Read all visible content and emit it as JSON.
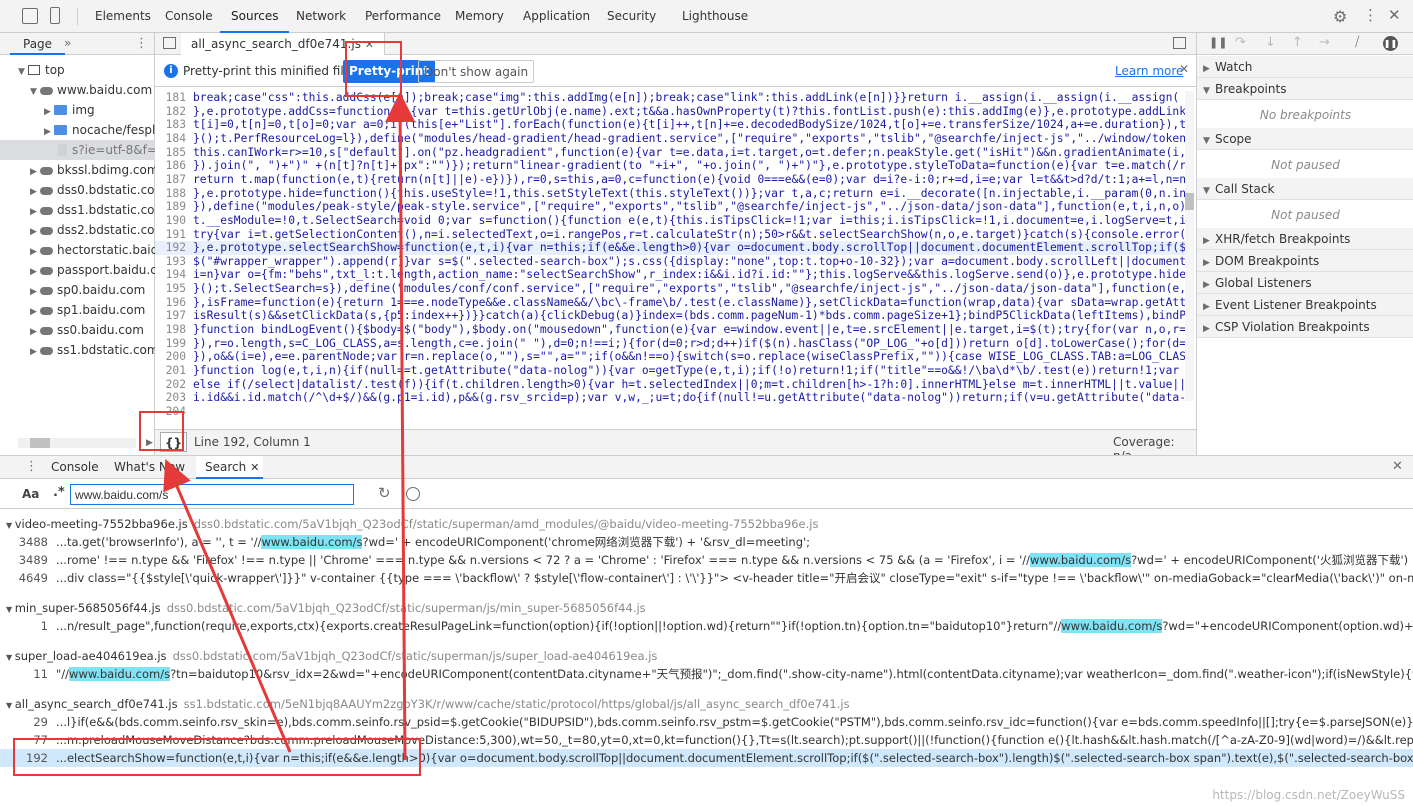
{
  "main_tabs": [
    "Elements",
    "Console",
    "Sources",
    "Network",
    "Performance",
    "Memory",
    "Application",
    "Security",
    "Lighthouse"
  ],
  "navigator": {
    "tab": "Page",
    "items": [
      {
        "label": "top",
        "kind": "frame"
      },
      {
        "label": "www.baidu.com",
        "kind": "cloud"
      },
      {
        "label": "img",
        "kind": "folder"
      },
      {
        "label": "nocache/fesplg",
        "kind": "folder"
      },
      {
        "label": "s?ie=utf-8&f=8",
        "kind": "file"
      },
      {
        "label": "bkssl.bdimg.com",
        "kind": "cloud"
      },
      {
        "label": "dss0.bdstatic.com",
        "kind": "cloud"
      },
      {
        "label": "dss1.bdstatic.com",
        "kind": "cloud"
      },
      {
        "label": "dss2.bdstatic.com",
        "kind": "cloud"
      },
      {
        "label": "hectorstatic.baidu",
        "kind": "cloud"
      },
      {
        "label": "passport.baidu.co",
        "kind": "cloud"
      },
      {
        "label": "sp0.baidu.com",
        "kind": "cloud"
      },
      {
        "label": "sp1.baidu.com",
        "kind": "cloud"
      },
      {
        "label": "ss0.baidu.com",
        "kind": "cloud"
      },
      {
        "label": "ss1.bdstatic.com",
        "kind": "cloud"
      }
    ]
  },
  "editor": {
    "file_tab": "all_async_search_df0e741.js",
    "infobar": {
      "message": "Pretty-print this minified file?",
      "pretty_button": "Pretty-print",
      "dismiss_button": "Don't show again",
      "learn_more": "Learn more"
    },
    "lines": [
      {
        "n": "181",
        "t": "break;case\"css\":this.addCss(e[n]);break;case\"img\":this.addImg(e[n]);break;case\"link\":this.addLink(e[n])}}return i.__assign(i.__assign(i.__assign("
      },
      {
        "n": "182",
        "t": "},e.prototype.addCss=function(e){var t=this.getUrlObj(e.name).ext;t&&a.hasOwnProperty(t)?this.fontList.push(e):this.addImg(e)},e.prototype.addLink=fu"
      },
      {
        "n": "183",
        "t": "t[i]=0,t[n]=0,t[o]=0;var a=0;if(this[e+\"List\"].forEach(function(e){t[i]++,t[n]+=e.decodedBodySize/1024,t[o]+=e.transferSize/1024,a+=e.duration}),t[s"
      },
      {
        "n": "184",
        "t": "}();t.PerfResourceLog=l}),define(\"modules/head-gradient/head-gradient.service\",[\"require\",\"exports\",\"tslib\",\"@searchfe/inject-js\",\"../window/token\",\""
      },
      {
        "n": "185",
        "t": "this.canIWork=r>=10,s[\"default\"].on(\"pz.headgradient\",function(e){var t=e.data,i=t.target,o=t.defer;n.peakStyle.get(\"isHit\")&&n.gradientAnimate(i,o)}"
      },
      {
        "n": "186",
        "t": "}).join(\", \")+\")\" +(n[t]?n[t]+\"px\":\"\")});return\"linear-gradient(to \"+i+\", \"+o.join(\", \")+\")\"},e.prototype.styleToData=function(e){var t=e.match(/rgba"
      },
      {
        "n": "187",
        "t": "return t.map(function(e,t){return(n[t]||e)-e})}),r=0,s=this,a=0,c=function(e){void 0===e&&(e=0);var d=i?e-i:0;r+=d,i=e;var l=t&&t>d?d/t:1;a+=l,n=n.ma"
      },
      {
        "n": "188",
        "t": "},e.prototype.hide=function(){this.useStyle=!1,this.setStyleText(this.styleText())};var t,a,c;return e=i.__decorate([n.injectable,i.__param(0,n.injec"
      },
      {
        "n": "189",
        "t": "}),define(\"modules/peak-style/peak-style.service\",[\"require\",\"exports\",\"tslib\",\"@searchfe/inject-js\",\"../json-data/json-data\"],function(e,t,i,n,o){"
      },
      {
        "n": "190",
        "t": "t.__esModule=!0,t.SelectSearch=void 0;var s=function(){function e(e,t){this.isTipsClick=!1;var i=this;i.isTipsClick=!1,i.document=e,i.logServe=t,i.se"
      },
      {
        "n": "191",
        "t": "try{var i=t.getSelectionContent(),n=i.selectedText,o=i.rangePos,r=t.calculateStr(n);50>r&&t.selectSearchShow(n,o,e.target)}catch(s){console.error(s)"
      },
      {
        "n": "192",
        "t": "},e.prototype.selectSearchShow=function(e,t,i){var n=this;if(e&&e.length>0){var o=document.body.scrollTop||document.documentElement.scrollTop;if($(\""
      },
      {
        "n": "193",
        "t": "$(\"#wrapper_wrapper\").append(r)}var s=$(\".selected-search-box\");s.css({display:\"none\",top:t.top+o-10-32});var a=document.body.scrollLeft||document.do"
      },
      {
        "n": "194",
        "t": "i=n}var o={fm:\"behs\",txt_l:t.length,action_name:\"selectSearchShow\",r_index:i&&i.id?i.id:\"\"};this.logServe&&this.logServe.send(o)},e.prototype.hideNo"
      },
      {
        "n": "195",
        "t": "}();t.SelectSearch=s}),define(\"modules/conf/conf.service\",[\"require\",\"exports\",\"tslib\",\"@searchfe/inject-js\",\"../json-data/json-data\"],function(e,t,i"
      },
      {
        "n": "196",
        "t": "},isFrame=function(e){return 1===e.nodeType&&e.className&&/\\bc\\-frame\\b/.test(e.className)},setClickData=function(wrap,data){var sData=wrap.getAttribu"
      },
      {
        "n": "197",
        "t": "isResult(s)&&setClickData(s,{p5:index++})}}catch(a){clickDebug(a)}index=(bds.comm.pageNum-1)*bds.comm.pageSize+1};bindP5ClickData(leftItems),bindP5Cl"
      },
      {
        "n": "198",
        "t": "}function bindLogEvent(){$body=$(\"body\"),$body.on(\"mousedown\",function(e){var e=window.event||e,t=e.srcElement||e.target,i=$(t);try{for(var n,o,r=i;r"
      },
      {
        "n": "199",
        "t": "}),r=o.length,s=C_LOG_CLASS,a=s.length,c=e.join(\" \"),d=0;n!==i;){for(d=0;r>d;d++)if($(n).hasClass(\"OP_LOG_\"+o[d]))return o[d].toLowerCase();for(d=0;a"
      },
      {
        "n": "200",
        "t": "}),o&&(i=e),e=e.parentNode;var r=n.replace(o,\"\"),s=\"\",a=\"\";if(o&&n!==o){switch(s=o.replace(wiseClassPrefix,\"\")){case WISE_LOG_CLASS.TAB:a=LOG_CLASS.I"
      },
      {
        "n": "201",
        "t": "}function log(e,t,i,n){if(null==t.getAttribute(\"data-nolog\")){var o=getType(e,t,i);if(!o)return!1;if(\"title\"==o&&!/\\ba\\d*\\b/.test(e))return!1;var r="
      },
      {
        "n": "202",
        "t": "else if(/select|datalist/.test(f)){if(t.children.length>0){var h=t.selectedIndex||0;m=t.children[h>-1?h:0].innerHTML}else m=t.innerHTML||t.value||\"\""
      },
      {
        "n": "203",
        "t": "i.id&&i.id.match(/^\\d+$/)&&(g.p1=i.id),p&&(g.rsv_srcid=p);var v,w,_;u=t;do{if(null!=u.getAttribute(\"data-nolog\"))return;if(v=u.getAttribute(\"data-cl"
      },
      {
        "n": "204",
        "t": ""
      }
    ],
    "status": {
      "format_label": "{}",
      "position": "Line 192, Column 1",
      "coverage": "Coverage: n/a"
    }
  },
  "debugger": {
    "sections": [
      "Watch",
      "Breakpoints",
      "Scope",
      "Call Stack",
      "XHR/fetch Breakpoints",
      "DOM Breakpoints",
      "Global Listeners",
      "Event Listener Breakpoints",
      "CSP Violation Breakpoints"
    ],
    "no_breakpoints": "No breakpoints",
    "not_paused": "Not paused"
  },
  "drawer": {
    "tabs": [
      "Console",
      "What's New",
      "Search"
    ],
    "match_case": "Aa",
    "regex": ".*",
    "search_value": "www.baidu.com/s",
    "results": [
      {
        "file": "video-meeting-7552bba96e.js",
        "path": "dss0.bdstatic.com/5aV1bjqh_Q23odCf/static/superman/amd_modules/@baidu/video-meeting-7552bba96e.js",
        "rows": [
          {
            "n": "3488",
            "pre": "...ta.get('browserInfo'), a = '', t = '//",
            "hl": "www.baidu.com/s",
            "post": "?wd=' + encodeURIComponent('chrome网络浏览器下载') + '&rsv_dl=meeting';"
          },
          {
            "n": "3489",
            "pre": "...rome' !== n.type && 'Firefox' !== n.type || 'Chrome' === n.type && n.versions < 72 ? a = 'Chrome' : 'Firefox' === n.type && n.versions < 75 && (a = 'Firefox', i = '//",
            "hl": "www.baidu.com/s",
            "post": "?wd=' + encodeURIComponent('火狐浏览器下载') + '&rsv_dl=meeti..."
          },
          {
            "n": "4649",
            "pre": "...div class=\"{{$style[\\'quick-wrapper\\']}}\" v-container {{type === \\'backflow\\' ? $style[\\'flow-container\\'] : \\'\\'}}\"> <v-header title=\"开启会议\" closeType=\"exit\" s-if=\"type !== \\'backflow\\'\" on-mediaGoback=\"clearMedia(\\'back\\')\" on-mediaExit=\"clearMedia(...",
            "hl": "",
            "post": ""
          }
        ]
      },
      {
        "file": "min_super-5685056f44.js",
        "path": "dss0.bdstatic.com/5aV1bjqh_Q23odCf/static/superman/js/min_super-5685056f44.js",
        "rows": [
          {
            "n": "1",
            "pre": "...n/result_page\",function(require,exports,ctx){exports.createResulPageLink=function(option){if(!option||!option.wd){return\"\"}if(!option.tn){option.tn=\"baidutop10\"}return\"//",
            "hl": "www.baidu.com/s",
            "post": "?wd=\"+encodeURIComponent(option.wd)+\"&ie=utf-8&tn=\"+option...."
          }
        ]
      },
      {
        "file": "super_load-ae404619ea.js",
        "path": "dss0.bdstatic.com/5aV1bjqh_Q23odCf/static/superman/js/super_load-ae404619ea.js",
        "rows": [
          {
            "n": "11",
            "pre": "\"//",
            "hl": "www.baidu.com/s",
            "post": "?tn=baidutop10&rsv_idx=2&wd=\"+encodeURIComponent(contentData.cityname+\"天气预报\")\";_dom.find(\".show-city-name\").html(contentData.cityname);var weatherIcon=_dom.find(\".weather-icon\");if(isNewStyle){weatherIcon.attr(\"src\",..."
          }
        ]
      },
      {
        "file": "all_async_search_df0e741.js",
        "path": "ss1.bdstatic.com/5eN1bjq8AAUYm2zgoY3K/r/www/cache/static/protocol/https/global/js/all_async_search_df0e741.js",
        "rows": [
          {
            "n": "29",
            "pre": "...l}if(e&&(bds.comm.seinfo.rsv_skin=e),bds.comm.seinfo.rsv_psid=$.getCookie(\"BIDUPSID\"),bds.comm.seinfo.rsv_pstm=$.getCookie(\"PSTM\"),bds.comm.seinfo.rsv_idc=function(){var e=bds.comm.speedInfo||[];try{e=$.parseJSON(e)}catch(t){e=[]}for(var i=0,n=...",
            "hl": "",
            "post": ""
          },
          {
            "n": "77",
            "pre": "...m.preloadMouseMoveDistance?bds.comm.preloadMouseMoveDistance:5,300),wt=50,_t=80,yt=0,xt=0,kt=function(){},Tt=s(lt.search);pt.support()||(!function(){function e(){lt.hash&&lt.hash.match(/[^a-zA-Z0-9](wd|word)=/)&&lt.replace(\"//",
            "hl": "www.baidu.com/s",
            "post": "?..."
          },
          {
            "n": "192",
            "pre": "...electSearchShow=function(e,t,i){var n=this;if(e&&e.length>0){var o=document.body.scrollTop||document.documentElement.scrollTop;if($(\".selected-search-box\").length)$(\".selected-search-box span\").text(e),$(\".selected-search-box a\").attr(\"href\",\"//",
            "hl": "www.b...",
            "post": ""
          }
        ]
      }
    ]
  },
  "watermark": "https://blog.csdn.net/ZoeyWuSS"
}
